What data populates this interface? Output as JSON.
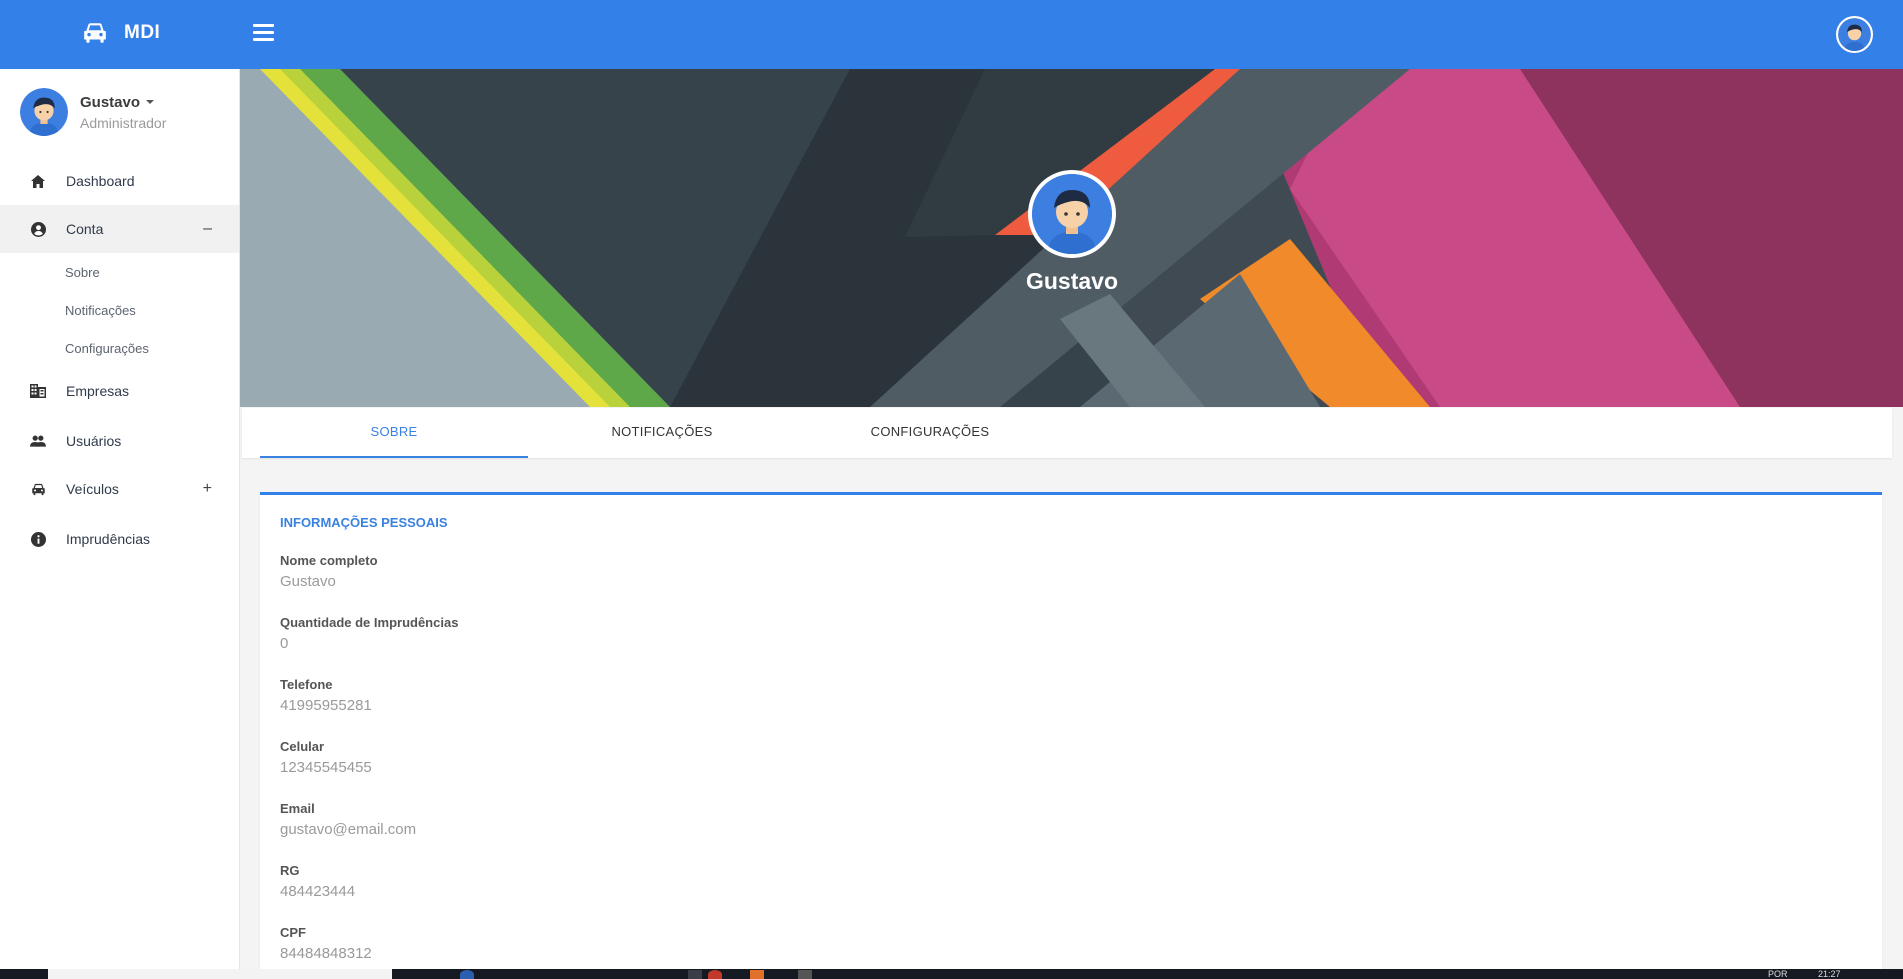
{
  "app": {
    "brand": "MDI"
  },
  "user": {
    "name": "Gustavo",
    "role": "Administrador"
  },
  "sidebar": {
    "items": [
      {
        "label": "Dashboard",
        "icon": "home-icon"
      },
      {
        "label": "Conta",
        "icon": "account-circle-icon",
        "toggle": "–",
        "expanded": true
      },
      {
        "label": "Empresas",
        "icon": "building-icon"
      },
      {
        "label": "Usuários",
        "icon": "people-icon"
      },
      {
        "label": "Veículos",
        "icon": "car-icon",
        "toggle": "+"
      },
      {
        "label": "Imprudências",
        "icon": "info-icon"
      }
    ],
    "sub_items": [
      "Sobre",
      "Notificações",
      "Configurações"
    ]
  },
  "profile": {
    "name": "Gustavo"
  },
  "tabs": [
    {
      "label": "SOBRE",
      "active": true
    },
    {
      "label": "NOTIFICAÇÕES",
      "active": false
    },
    {
      "label": "CONFIGURAÇÕES",
      "active": false
    }
  ],
  "card": {
    "title": "INFORMAÇÕES PESSOAIS",
    "fields": [
      {
        "label": "Nome completo",
        "value": "Gustavo"
      },
      {
        "label": "Quantidade de Imprudências",
        "value": "0"
      },
      {
        "label": "Telefone",
        "value": "41995955281"
      },
      {
        "label": "Celular",
        "value": "12345545455"
      },
      {
        "label": "Email",
        "value": "gustavo@email.com"
      },
      {
        "label": "RG",
        "value": "484423444"
      },
      {
        "label": "CPF",
        "value": "84484848312"
      }
    ]
  },
  "taskbar": {
    "lang": "POR",
    "time": "21:27"
  },
  "colors": {
    "primary": "#3381e8",
    "accent_text": "#3a82e0",
    "sidebar_bg": "#ffffff"
  }
}
